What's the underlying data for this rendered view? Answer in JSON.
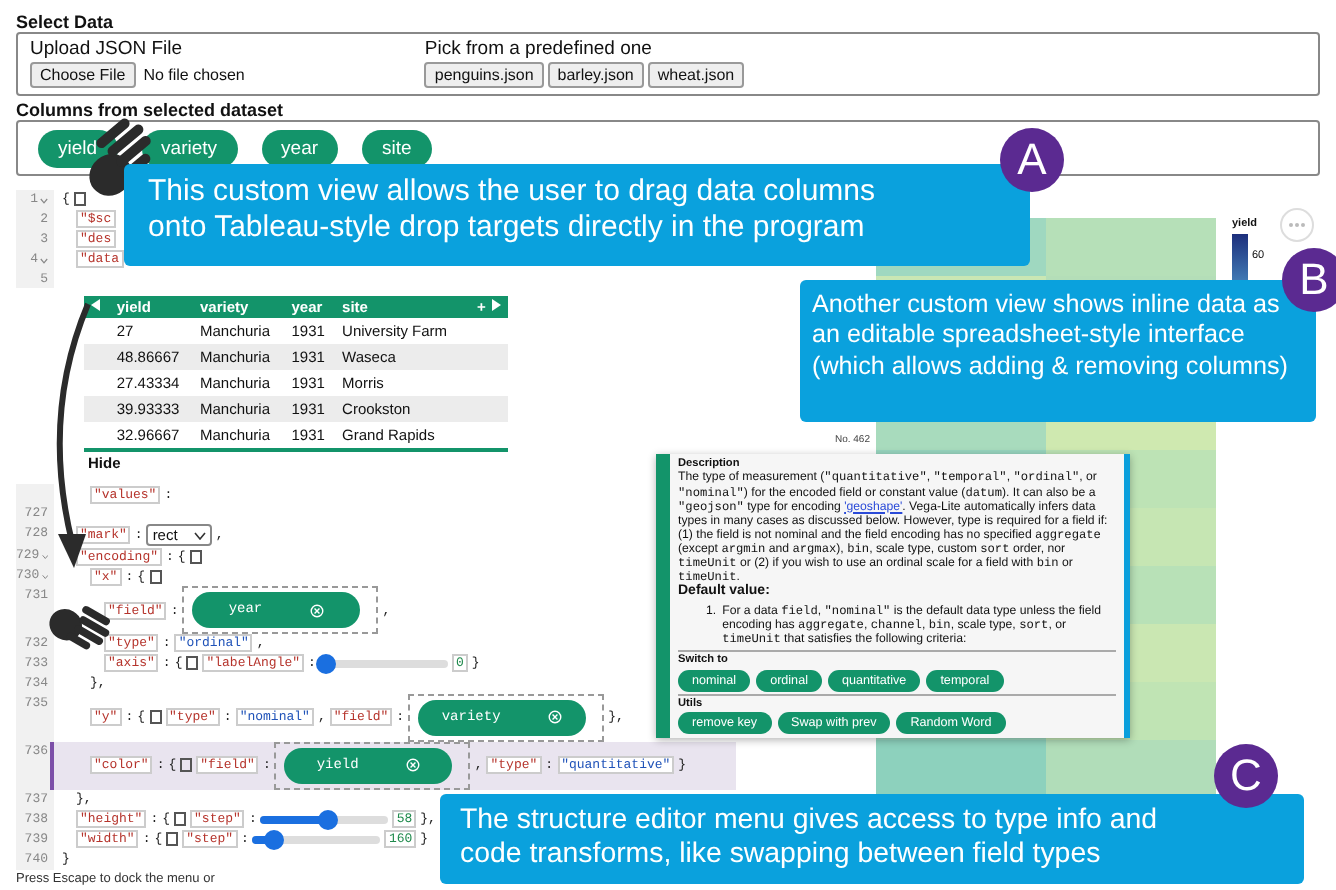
{
  "select_data": {
    "title": "Select Data",
    "upload_label": "Upload JSON File",
    "choose_button": "Choose File",
    "file_status": "No file chosen",
    "predefined_label": "Pick from a predefined one",
    "datasets": [
      "penguins.json",
      "barley.json",
      "wheat.json"
    ]
  },
  "columns_section": {
    "title": "Columns from selected dataset",
    "columns": [
      "yield",
      "variety",
      "year",
      "site"
    ]
  },
  "editor": {
    "lines": [
      {
        "kind": "line",
        "number": "1",
        "fold": true,
        "selected": false,
        "tokens": [
          {
            "kind": "punct",
            "text": "{"
          },
          {
            "kind": "toggle"
          }
        ],
        "children": [
          {
            "kind": "line",
            "number": "2",
            "fold": false,
            "selected": false,
            "tokens": [
              {
                "kind": "key",
                "text": "\"$sc"
              }
            ]
          },
          {
            "kind": "line",
            "number": "3",
            "fold": false,
            "selected": false,
            "tokens": [
              {
                "kind": "key",
                "text": "\"des"
              }
            ]
          },
          {
            "kind": "line",
            "number": "4",
            "fold": true,
            "selected": false,
            "tokens": [
              {
                "kind": "key",
                "text": "\"data"
              }
            ],
            "children": [
              {
                "kind": "line",
                "number": "5",
                "fold": false,
                "selected": false
              },
              {
                "kind": "table",
                "columns": [
                  "yield",
                  "variety",
                  "year",
                  "site"
                ],
                "add_label": "+",
                "rows": [
                  [
                    "27",
                    "Manchuria",
                    "1931",
                    "University Farm"
                  ],
                  [
                    "48.86667",
                    "Manchuria",
                    "1931",
                    "Waseca"
                  ],
                  [
                    "27.43334",
                    "Manchuria",
                    "1931",
                    "Morris"
                  ],
                  [
                    "39.93333",
                    "Manchuria",
                    "1931",
                    "Crookston"
                  ],
                  [
                    "32.96667",
                    "Manchuria",
                    "1931",
                    "Grand Rapids"
                  ]
                ],
                "hide_label": "Hide"
              },
              {
                "kind": "line",
                "fold": false,
                "selected": false,
                "tokens": [
                  {
                    "kind": "key",
                    "text": "\"values\""
                  },
                  {
                    "kind": "punct",
                    "text": ":"
                  }
                ]
              }
            ]
          },
          {
            "kind": "line",
            "number": "727",
            "fold": false,
            "selected": false
          },
          {
            "kind": "line",
            "number": "728",
            "fold": false,
            "selected": false,
            "tokens": [
              {
                "kind": "key",
                "text": "\"mark\""
              },
              {
                "kind": "punct",
                "text": ":"
              },
              {
                "kind": "select",
                "text": "rect"
              },
              {
                "kind": "punct",
                "text": ","
              }
            ]
          },
          {
            "kind": "line",
            "number": "729",
            "fold": true,
            "selected": false,
            "tokens": [
              {
                "kind": "key",
                "text": "\"encoding\""
              },
              {
                "kind": "punct",
                "text": ":"
              },
              {
                "kind": "punct",
                "text": "{"
              },
              {
                "kind": "toggle"
              }
            ],
            "children": [
              {
                "kind": "line",
                "number": "730",
                "fold": true,
                "selected": false,
                "tokens": [
                  {
                    "kind": "key",
                    "text": "\"x\""
                  },
                  {
                    "kind": "punct",
                    "text": ":"
                  },
                  {
                    "kind": "punct",
                    "text": "{"
                  },
                  {
                    "kind": "toggle"
                  }
                ],
                "children": [
                  {
                    "kind": "line",
                    "number": "731",
                    "fold": false,
                    "selected": false,
                    "tokens": [
                      {
                        "kind": "key",
                        "text": "\"field\""
                      },
                      {
                        "kind": "punct",
                        "text": ":"
                      },
                      {
                        "kind": "chip",
                        "text": "year"
                      },
                      {
                        "kind": "punct",
                        "text": ","
                      }
                    ]
                  },
                  {
                    "kind": "line",
                    "number": "732",
                    "fold": false,
                    "selected": false,
                    "tokens": [
                      {
                        "kind": "key",
                        "text": "\"type\""
                      },
                      {
                        "kind": "punct",
                        "text": ":"
                      },
                      {
                        "kind": "string",
                        "text": "\"ordinal\""
                      },
                      {
                        "kind": "punct",
                        "text": ","
                      }
                    ]
                  },
                  {
                    "kind": "line",
                    "number": "733",
                    "fold": false,
                    "selected": false,
                    "tokens": [
                      {
                        "kind": "key",
                        "text": "\"axis\""
                      },
                      {
                        "kind": "punct",
                        "text": ":"
                      },
                      {
                        "kind": "punct",
                        "text": "{"
                      },
                      {
                        "kind": "toggle"
                      },
                      {
                        "kind": "key",
                        "text": "\"labelAngle\""
                      },
                      {
                        "kind": "punct",
                        "text": ":"
                      },
                      {
                        "kind": "slider",
                        "level": 0.05
                      },
                      {
                        "kind": "number",
                        "text": "0"
                      },
                      {
                        "kind": "punct",
                        "text": "}"
                      }
                    ]
                  }
                ]
              },
              {
                "kind": "line",
                "number": "734",
                "fold": false,
                "selected": false,
                "tokens": [
                  {
                    "kind": "punct",
                    "text": "},"
                  }
                ]
              },
              {
                "kind": "line",
                "number": "735",
                "fold": false,
                "selected": false,
                "tokens": [
                  {
                    "kind": "key",
                    "text": "\"y\""
                  },
                  {
                    "kind": "punct",
                    "text": ":"
                  },
                  {
                    "kind": "punct",
                    "text": "{"
                  },
                  {
                    "kind": "toggle"
                  },
                  {
                    "kind": "key",
                    "text": "\"type\""
                  },
                  {
                    "kind": "punct",
                    "text": ":"
                  },
                  {
                    "kind": "string",
                    "text": "\"nominal\""
                  },
                  {
                    "kind": "punct",
                    "text": ","
                  },
                  {
                    "kind": "key",
                    "text": "\"field\""
                  },
                  {
                    "kind": "punct",
                    "text": ":"
                  },
                  {
                    "kind": "chip",
                    "text": "variety"
                  },
                  {
                    "kind": "punct",
                    "text": "},"
                  }
                ]
              },
              {
                "kind": "line",
                "number": "736",
                "fold": false,
                "selected": true,
                "tokens": [
                  {
                    "kind": "key",
                    "text": "\"color\""
                  },
                  {
                    "kind": "punct",
                    "text": ":"
                  },
                  {
                    "kind": "punct",
                    "text": "{"
                  },
                  {
                    "kind": "toggle"
                  },
                  {
                    "kind": "key",
                    "text": "\"field\""
                  },
                  {
                    "kind": "punct",
                    "text": ":"
                  },
                  {
                    "kind": "chip",
                    "text": "yield"
                  },
                  {
                    "kind": "punct",
                    "text": ","
                  },
                  {
                    "kind": "key",
                    "text": "\"type\""
                  },
                  {
                    "kind": "punct",
                    "text": ":"
                  },
                  {
                    "kind": "string",
                    "text": "\"quantitative\""
                  },
                  {
                    "kind": "punct",
                    "text": "}"
                  }
                ]
              }
            ]
          },
          {
            "kind": "line",
            "number": "737",
            "fold": false,
            "selected": false,
            "tokens": [
              {
                "kind": "punct",
                "text": "},"
              }
            ]
          },
          {
            "kind": "line",
            "number": "738",
            "fold": false,
            "selected": false,
            "tokens": [
              {
                "kind": "key",
                "text": "\"height\""
              },
              {
                "kind": "punct",
                "text": ":"
              },
              {
                "kind": "punct",
                "text": "{"
              },
              {
                "kind": "toggle"
              },
              {
                "kind": "key",
                "text": "\"step\""
              },
              {
                "kind": "punct",
                "text": ":"
              },
              {
                "kind": "slider",
                "level": 0.52
              },
              {
                "kind": "number",
                "text": "58"
              },
              {
                "kind": "punct",
                "text": "},"
              }
            ]
          },
          {
            "kind": "line",
            "number": "739",
            "fold": false,
            "selected": false,
            "tokens": [
              {
                "kind": "key",
                "text": "\"width\""
              },
              {
                "kind": "punct",
                "text": ":"
              },
              {
                "kind": "punct",
                "text": "{"
              },
              {
                "kind": "toggle"
              },
              {
                "kind": "key",
                "text": "\"step\""
              },
              {
                "kind": "punct",
                "text": ":"
              },
              {
                "kind": "slider",
                "level": 0.17
              },
              {
                "kind": "number",
                "text": "160"
              },
              {
                "kind": "punct",
                "text": "}"
              }
            ]
          }
        ]
      },
      {
        "kind": "line",
        "number": "740",
        "fold": false,
        "selected": false,
        "tokens": [
          {
            "kind": "punct",
            "text": "}"
          }
        ]
      }
    ],
    "footer": "Press Escape to dock the menu or"
  },
  "chart": {
    "axis_label": "No. 462",
    "legend_title": "yield",
    "legend_tick": "60"
  },
  "menu": {
    "description_title": "Description",
    "description": [
      {
        "kind": "text",
        "text": "The type of measurement ("
      },
      {
        "kind": "code",
        "text": "\"quantitative\""
      },
      {
        "kind": "text",
        "text": ", "
      },
      {
        "kind": "code",
        "text": "\"temporal\""
      },
      {
        "kind": "text",
        "text": ", "
      },
      {
        "kind": "code",
        "text": "\"ordinal\""
      },
      {
        "kind": "text",
        "text": ", or "
      },
      {
        "kind": "code",
        "text": "\"nominal\""
      },
      {
        "kind": "text",
        "text": ") for the encoded field or constant value ("
      },
      {
        "kind": "code",
        "text": "datum"
      },
      {
        "kind": "text",
        "text": "). It can also be a "
      },
      {
        "kind": "code",
        "text": "\"geojson\""
      },
      {
        "kind": "text",
        "text": " type for encoding "
      },
      {
        "kind": "link",
        "text": "'geoshape'"
      },
      {
        "kind": "text",
        "text": ". Vega-Lite automatically infers data types in many cases as discussed below. However, type is required for a field if: (1) the field is not nominal and the field encoding has no specified "
      },
      {
        "kind": "code",
        "text": "aggregate"
      },
      {
        "kind": "text",
        "text": " (except "
      },
      {
        "kind": "code",
        "text": "argmin"
      },
      {
        "kind": "text",
        "text": " and "
      },
      {
        "kind": "code",
        "text": "argmax"
      },
      {
        "kind": "text",
        "text": "), "
      },
      {
        "kind": "code",
        "text": "bin"
      },
      {
        "kind": "text",
        "text": ", scale type, custom "
      },
      {
        "kind": "code",
        "text": "sort"
      },
      {
        "kind": "text",
        "text": " order, nor "
      },
      {
        "kind": "code",
        "text": "timeUnit"
      },
      {
        "kind": "text",
        "text": " or (2) if you wish to use an ordinal scale for a field with "
      },
      {
        "kind": "code",
        "text": "bin"
      },
      {
        "kind": "text",
        "text": " or "
      },
      {
        "kind": "code",
        "text": "timeUnit"
      },
      {
        "kind": "text",
        "text": "."
      }
    ],
    "default_title": "Default value:",
    "default_items": [
      {
        "marker": "1.",
        "segments": [
          {
            "kind": "text",
            "text": "For a data "
          },
          {
            "kind": "code",
            "text": "field"
          },
          {
            "kind": "text",
            "text": ", "
          },
          {
            "kind": "code",
            "text": "\"nominal\""
          },
          {
            "kind": "text",
            "text": " is the default data type unless the field encoding has "
          },
          {
            "kind": "code",
            "text": "aggregate"
          },
          {
            "kind": "text",
            "text": ", "
          },
          {
            "kind": "code",
            "text": "channel"
          },
          {
            "kind": "text",
            "text": ", "
          },
          {
            "kind": "code",
            "text": "bin"
          },
          {
            "kind": "text",
            "text": ", scale type, "
          },
          {
            "kind": "code",
            "text": "sort"
          },
          {
            "kind": "text",
            "text": ", or "
          },
          {
            "kind": "code",
            "text": "timeUnit"
          },
          {
            "kind": "text",
            "text": " that satisfies the following criteria:"
          }
        ]
      }
    ],
    "switch_title": "Switch to",
    "switch_buttons": [
      "nominal",
      "ordinal",
      "quantitative",
      "temporal"
    ],
    "utils_title": "Utils",
    "utils_buttons": [
      "remove key",
      "Swap with prev",
      "Random Word"
    ]
  },
  "callouts": [
    {
      "badge": "A",
      "text": "This custom view allows the user to drag data columns onto Tableau-style drop targets directly in the program"
    },
    {
      "badge": "B",
      "text": "Another custom view shows inline data as an editable spreadsheet-style interface (which allows adding & removing columns)"
    },
    {
      "badge": "C",
      "text": "The structure editor menu gives access to type info and code transforms, like swapping between field types"
    }
  ]
}
